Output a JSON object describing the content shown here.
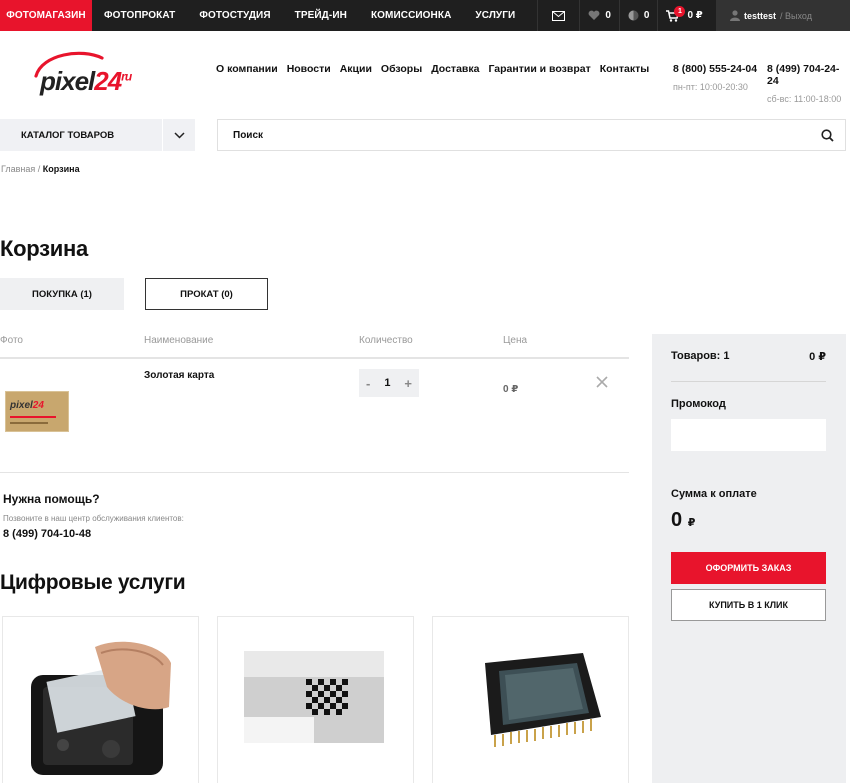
{
  "topbar": {
    "nav": [
      "ФОТОМАГАЗИН",
      "ФОТОПРОКАТ",
      "ФОТОСТУДИЯ",
      "ТРЕЙД-ИН",
      "КОМИССИОНКА",
      "УСЛУГИ"
    ],
    "favorites_count": "0",
    "compare_count": "0",
    "cart_badge": "1",
    "cart_total": "0 ₽",
    "username": "testtest",
    "logout": "/ Выход"
  },
  "header": {
    "logo_text": "pixel",
    "logo_num": "24",
    "logo_tld": "ru",
    "menu": [
      "О компании",
      "Новости",
      "Акции",
      "Обзоры",
      "Доставка",
      "Гарантии и возврат",
      "Контакты"
    ],
    "phone1": "8 (800) 555-24-04",
    "hours1": "пн-пт: 10:00-20:30",
    "phone2": "8 (499) 704-24-24",
    "hours2": "сб-вс: 11:00-18:00"
  },
  "catalog_label": "КАТАЛОГ ТОВАРОВ",
  "search_placeholder": "Поиск",
  "breadcrumb": {
    "home": "Главная",
    "sep": " / ",
    "current": "Корзина"
  },
  "page_title": "Корзина",
  "tabs": {
    "purchase": "ПОКУПКА (1)",
    "rent": "ПРОКАТ (0)"
  },
  "table": {
    "headers": {
      "photo": "Фото",
      "name": "Наименование",
      "qty": "Количество",
      "price": "Цена"
    },
    "rows": [
      {
        "name": "Золотая карта",
        "qty": "1",
        "price": "0 ₽",
        "minus": "-",
        "plus": "+"
      }
    ]
  },
  "help": {
    "title": "Нужна помощь?",
    "text": "Позвоните в наш центр обслуживания клиентов:",
    "phone": "8 (499) 704-10-48"
  },
  "services_title": "Цифровые услуги",
  "summary": {
    "items_label": "Товаров: 1",
    "items_sum": "0 ₽",
    "promo_label": "Промокод",
    "total_label": "Сумма к оплате",
    "total_value": "0",
    "currency": "₽",
    "order_button": "ОФОРМИТЬ ЗАКАЗ",
    "oneclick_button": "КУПИТЬ В 1 КЛИК"
  },
  "colors": {
    "accent": "#e8142c",
    "topbar": "#1f1f1f",
    "panel": "#eeeff1"
  }
}
